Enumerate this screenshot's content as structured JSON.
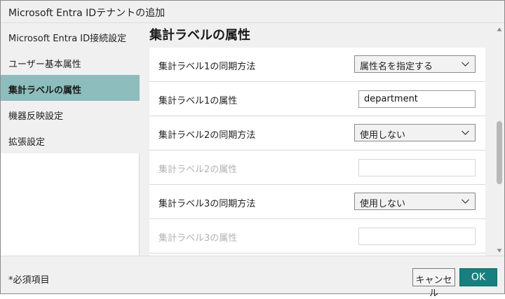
{
  "window": {
    "title": "Microsoft Entra IDテナントの追加"
  },
  "sidebar": {
    "items": [
      {
        "label": "Microsoft Entra ID接続設定",
        "active": false
      },
      {
        "label": "ユーザー基本属性",
        "active": false
      },
      {
        "label": "集計ラベルの属性",
        "active": true
      },
      {
        "label": "機器反映設定",
        "active": false
      },
      {
        "label": "拡張設定",
        "active": false
      }
    ]
  },
  "section": {
    "title": "集計ラベルの属性"
  },
  "form": {
    "rows": [
      {
        "label": "集計ラベル1の同期方法",
        "type": "select",
        "value": "属性名を指定する",
        "disabled": false
      },
      {
        "label": "集計ラベル1の属性",
        "type": "text",
        "value": "department",
        "disabled": false
      },
      {
        "label": "集計ラベル2の同期方法",
        "type": "select",
        "value": "使用しない",
        "disabled": false
      },
      {
        "label": "集計ラベル2の属性",
        "type": "text",
        "value": "",
        "disabled": true
      },
      {
        "label": "集計ラベル3の同期方法",
        "type": "select",
        "value": "使用しない",
        "disabled": false
      },
      {
        "label": "集計ラベル3の属性",
        "type": "text",
        "value": "",
        "disabled": true
      }
    ]
  },
  "footer": {
    "required_note": "*必須項目",
    "cancel_label": "キャンセル",
    "ok_label": "OK"
  },
  "colors": {
    "active_sidebar": "#8dbdbd",
    "ok_button": "#17807e"
  },
  "icons": {
    "select_arrow": "chevron-down-icon",
    "scroll_up": "scroll-up-arrow-icon",
    "scroll_down": "scroll-down-arrow-icon"
  }
}
